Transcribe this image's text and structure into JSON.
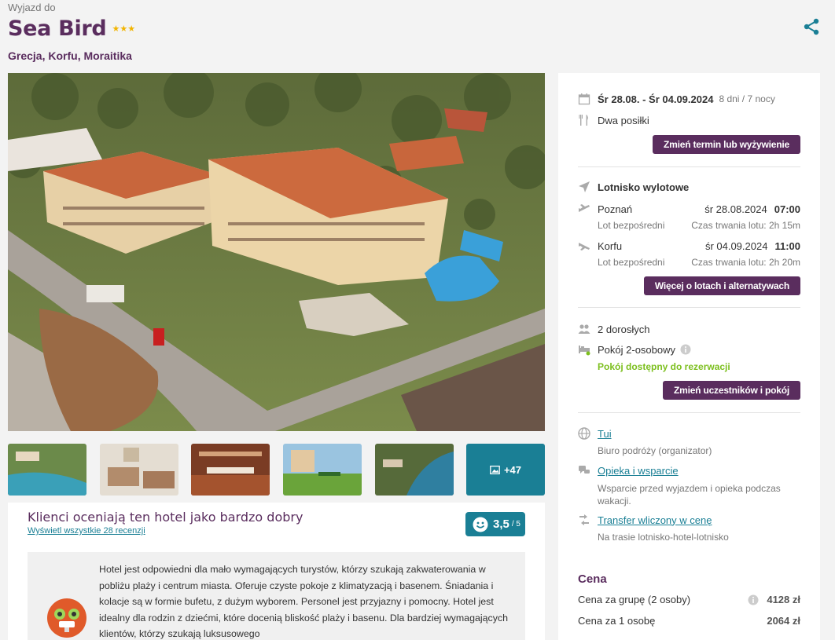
{
  "header": {
    "pre_title": "Wyjazd do",
    "hotel_name": "Sea Bird",
    "stars": "★★★",
    "location": "Grecja, Korfu, Moraitika"
  },
  "gallery": {
    "more_count": "+47"
  },
  "reviews": {
    "title": "Klienci oceniają ten hotel jako bardzo dobry",
    "link": "Wyświetl wszystkie 28 recenzji",
    "score": "3,5",
    "score_max": "/ 5",
    "summary": "Hotel jest odpowiedni dla mało wymagających turystów, którzy szukają zakwaterowania w pobliżu plaży i centrum miasta. Oferuje czyste pokoje z klimatyzacją i basenem. Śniadania i kolacje są w formie bufetu, z dużym wyborem. Personel jest przyjazny i pomocny. Hotel jest idealny dla rodzin z dziećmi, które docenią bliskość plaży i basenu. Dla bardziej wymagających klientów, którzy szukają luksusowego"
  },
  "sidebar": {
    "dates": "Śr 28.08. - Śr 04.09.2024",
    "duration": "8 dni / 7 nocy",
    "meals": "Dwa posiłki",
    "change_date_button": "Zmień termin lub wyżywienie",
    "airport_label": "Lotnisko wylotowe",
    "outbound": {
      "city": "Poznań",
      "date": "śr 28.08.2024",
      "time": "07:00",
      "type": "Lot bezpośredni",
      "duration": "Czas trwania lotu: 2h 15m"
    },
    "inbound": {
      "city": "Korfu",
      "date": "śr 04.09.2024",
      "time": "11:00",
      "type": "Lot bezpośredni",
      "duration": "Czas trwania lotu: 2h 20m"
    },
    "flights_button": "Więcej o lotach i alternatywach",
    "adults": "2 dorosłych",
    "room": "Pokój 2-osobowy",
    "room_status": "Pokój dostępny do rezerwacji",
    "participants_button": "Zmień uczestników i pokój",
    "organizer_name": "Tui",
    "organizer_desc": "Biuro podróży (organizator)",
    "care_link": "Opieka i wsparcie",
    "care_desc": "Wsparcie przed wyjazdem i opieka podczas wakacji.",
    "transfer_link": "Transfer wliczony w cenę",
    "transfer_desc": "Na trasie lotnisko-hotel-lotnisko",
    "price_heading": "Cena",
    "price_group_label": "Cena za grupę (2 osoby)",
    "price_group_value": "4128 zł",
    "price_person_label": "Cena za 1 osobę",
    "price_person_value": "2064 zł"
  },
  "colors": {
    "brand": "#5a2d5e",
    "accent": "#1a7f95",
    "available": "#7cbf1e"
  },
  "icons": [
    "share-icon",
    "calendar-icon",
    "cutlery-icon",
    "plane-icon",
    "takeoff-icon",
    "landing-icon",
    "people-icon",
    "bed-icon",
    "info-icon",
    "globe-icon",
    "support-icon",
    "transfer-icon",
    "gallery-icon",
    "smiley-icon"
  ]
}
